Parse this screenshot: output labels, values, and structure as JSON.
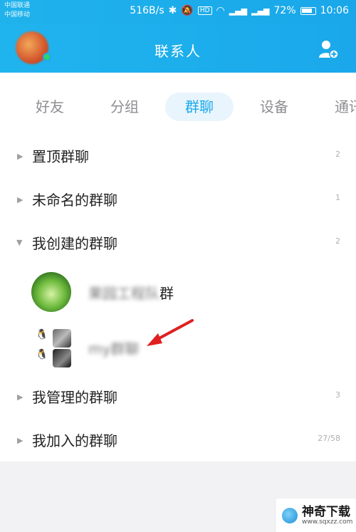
{
  "status_bar": {
    "carrier_line1": "中国联通",
    "carrier_line2": "中国移动",
    "speed": "516B/s",
    "battery": "72%",
    "time": "10:06"
  },
  "header": {
    "title": "联系人"
  },
  "tabs": [
    {
      "label": "好友",
      "active": false
    },
    {
      "label": "分组",
      "active": false
    },
    {
      "label": "群聊",
      "active": true
    },
    {
      "label": "设备",
      "active": false
    },
    {
      "label": "通讯",
      "active": false
    }
  ],
  "groups": {
    "pinned": {
      "name": "置顶群聊",
      "count": "2"
    },
    "unnamed": {
      "name": "未命名的群聊",
      "count": "1"
    },
    "created": {
      "name": "我创建的群聊",
      "count": "2"
    },
    "managed": {
      "name": "我管理的群聊",
      "count": "3"
    },
    "joined": {
      "name": "我加入的群聊",
      "count": "27/58"
    }
  },
  "created_members": [
    {
      "name_blurred": "果园工程队",
      "name_suffix": "群"
    },
    {
      "name_blurred": "my",
      "name_suffix": "群聊"
    }
  ],
  "watermark": {
    "brand": "神奇下载",
    "url": "www.sqxzz.com"
  },
  "colors": {
    "header": "#1aa8eb",
    "accent": "#1aa8eb",
    "annotation_arrow": "#e02020"
  }
}
